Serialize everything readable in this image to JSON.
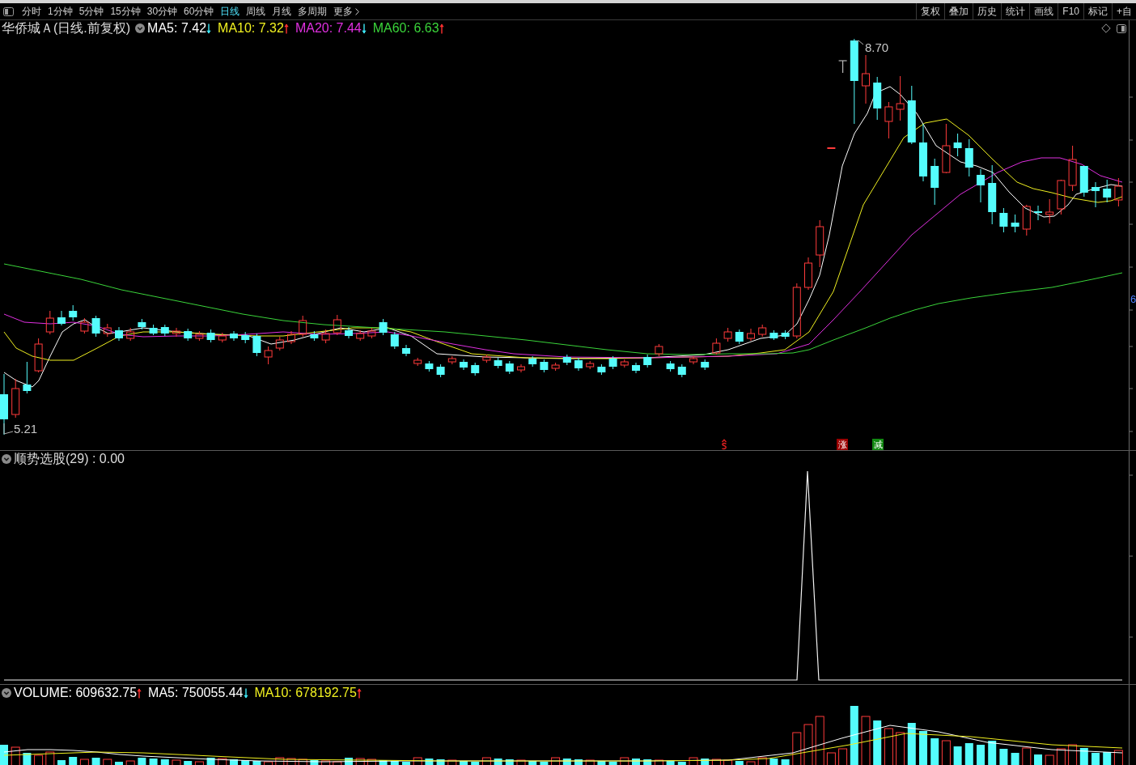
{
  "toolbar": {
    "periods": [
      {
        "label": "分时",
        "selected": false
      },
      {
        "label": "1分钟",
        "selected": false
      },
      {
        "label": "5分钟",
        "selected": false
      },
      {
        "label": "15分钟",
        "selected": false
      },
      {
        "label": "30分钟",
        "selected": false
      },
      {
        "label": "60分钟",
        "selected": false
      },
      {
        "label": "日线",
        "selected": true
      },
      {
        "label": "周线",
        "selected": false
      },
      {
        "label": "月线",
        "selected": false
      },
      {
        "label": "多周期",
        "selected": false
      }
    ],
    "more": "更多",
    "tools": [
      "复权",
      "叠加",
      "历史",
      "统计",
      "画线",
      "F10",
      "标记",
      "+自"
    ]
  },
  "main_chart": {
    "title": "华侨城Ａ(日线.前复权)",
    "ma_lines": [
      {
        "label": "MA5: 7.42",
        "rising": false,
        "color": "#ffffff"
      },
      {
        "label": "MA10: 7.32",
        "rising": true,
        "color": "#f0f020"
      },
      {
        "label": "MA20: 7.44",
        "rising": false,
        "color": "#e030e0"
      },
      {
        "label": "MA60: 6.63",
        "rising": true,
        "color": "#3ad43a"
      }
    ],
    "high_label": "8.70",
    "low_label": "5.21",
    "signals": [
      {
        "text": "涨",
        "color": "#990000"
      },
      {
        "text": "减",
        "color": "#118811"
      }
    ],
    "price_axis_label": "6"
  },
  "indicator": {
    "title": "顺势选股(29) : 0.00"
  },
  "volume": {
    "legend": [
      {
        "label": "VOLUME: 609632.75",
        "rising": true,
        "color": "#ffffff"
      },
      {
        "label": "MA5: 750055.44",
        "rising": false,
        "color": "#ffffff"
      },
      {
        "label": "MA10: 678192.75",
        "rising": true,
        "color": "#f0f020"
      }
    ]
  }
}
